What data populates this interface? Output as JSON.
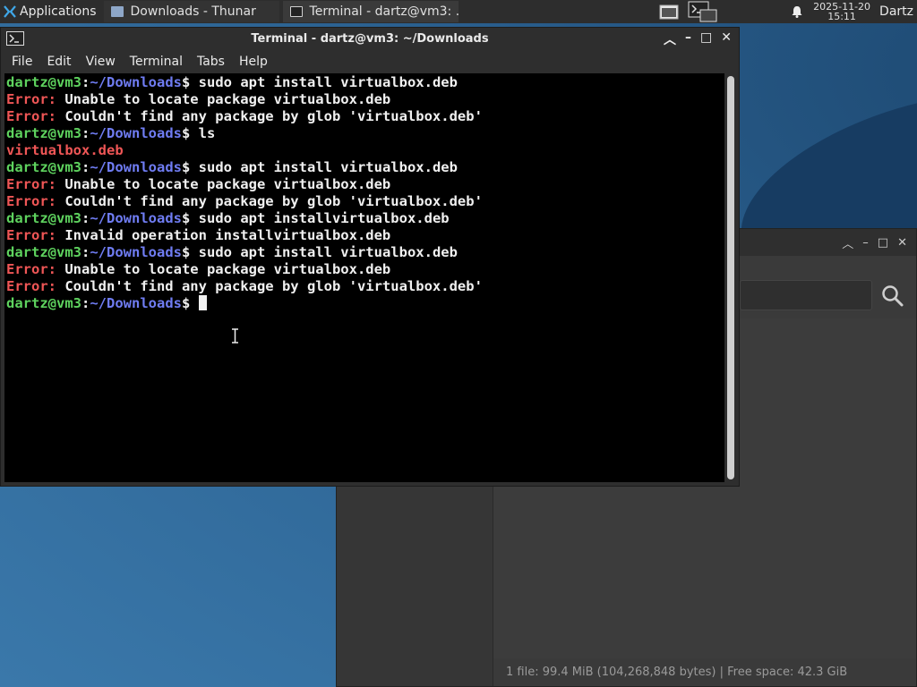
{
  "panel": {
    "applications_label": "Applications",
    "tasks": [
      {
        "label": "Downloads - Thunar",
        "icon": "folder-icon"
      },
      {
        "label": "Terminal - dartz@vm3: ...",
        "icon": "terminal-icon"
      }
    ],
    "clock_date": "2025-11-20",
    "clock_time": "15:11",
    "user": "Dartz"
  },
  "terminal": {
    "title": "Terminal - dartz@vm3: ~/Downloads",
    "menu": [
      "File",
      "Edit",
      "View",
      "Terminal",
      "Tabs",
      "Help"
    ],
    "lines": [
      {
        "type": "prompt",
        "user": "dartz@vm3",
        "path": "~/Downloads",
        "cmd": "sudo apt install virtualbox.deb"
      },
      {
        "type": "error",
        "label": "Error:",
        "msg": "Unable to locate package virtualbox.deb"
      },
      {
        "type": "error",
        "label": "Error:",
        "msg": "Couldn't find any package by glob 'virtualbox.deb'"
      },
      {
        "type": "prompt",
        "user": "dartz@vm3",
        "path": "~/Downloads",
        "cmd": "ls"
      },
      {
        "type": "file",
        "text": "virtualbox.deb"
      },
      {
        "type": "prompt",
        "user": "dartz@vm3",
        "path": "~/Downloads",
        "cmd": "sudo apt install virtualbox.deb"
      },
      {
        "type": "error",
        "label": "Error:",
        "msg": "Unable to locate package virtualbox.deb"
      },
      {
        "type": "error",
        "label": "Error:",
        "msg": "Couldn't find any package by glob 'virtualbox.deb'"
      },
      {
        "type": "prompt",
        "user": "dartz@vm3",
        "path": "~/Downloads",
        "cmd": "sudo apt installvirtualbox.deb"
      },
      {
        "type": "error",
        "label": "Error:",
        "msg": "Invalid operation installvirtualbox.deb"
      },
      {
        "type": "prompt",
        "user": "dartz@vm3",
        "path": "~/Downloads",
        "cmd": "sudo apt install virtualbox.deb"
      },
      {
        "type": "error",
        "label": "Error:",
        "msg": "Unable to locate package virtualbox.deb"
      },
      {
        "type": "error",
        "label": "Error:",
        "msg": "Couldn't find any package by glob 'virtualbox.deb'"
      },
      {
        "type": "prompt",
        "user": "dartz@vm3",
        "path": "~/Downloads",
        "cmd": "",
        "cursor": true
      }
    ],
    "colors": {
      "user": "#5ed25e",
      "path": "#6f7cf2",
      "error": "#ef5656",
      "background": "#000000"
    }
  },
  "thunar": {
    "status": "1 file: 99.4 MiB (104,268,848 bytes)  |  Free space: 42.3 GiB"
  }
}
